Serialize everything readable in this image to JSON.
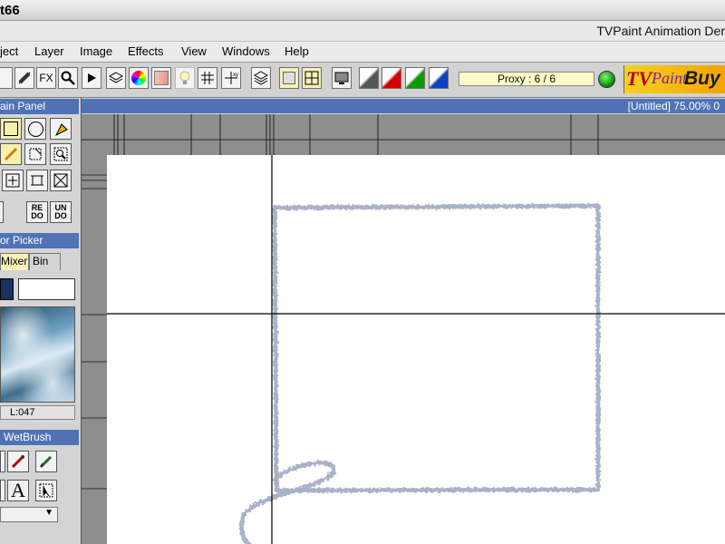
{
  "window": {
    "title_fragment": "t66",
    "app_title": "TVPaint Animation Der"
  },
  "menubar": {
    "items": [
      "ject",
      "Layer",
      "Image",
      "Effects",
      "View",
      "Windows",
      "Help"
    ]
  },
  "toolbar": {
    "fx_label": "FX",
    "proxy_text": "Proxy : 6 / 6",
    "buy_label": "Buy",
    "logo_text_1": "TV",
    "logo_text_2": "Paint"
  },
  "main_panel": {
    "title": "ain Panel",
    "redo_label": "RE DO",
    "undo_label": "UN DO"
  },
  "color_picker": {
    "title": "or Picker",
    "tabs": [
      "Mixer",
      "Bin"
    ],
    "active_tab": "Mixer",
    "readout": "L:047",
    "primary_color": "#1d2f5c",
    "secondary_color": "#ffffff"
  },
  "brush_panel": {
    "title": "WetBrush",
    "text_tool_label": "A"
  },
  "canvas": {
    "info": "[Untitled]  75.00%   0",
    "stroke_color": "#aab2c8"
  },
  "colors": {
    "panel_header": "#4f73b6",
    "led": "#1fb81f"
  }
}
